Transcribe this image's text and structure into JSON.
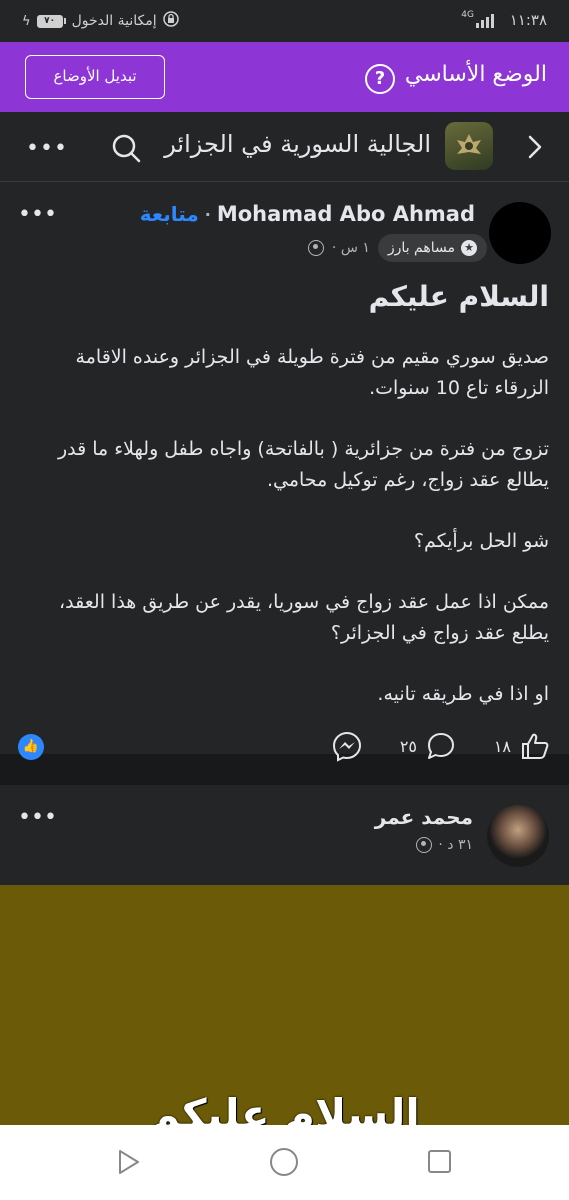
{
  "status_bar": {
    "time": "١١:٣٨",
    "network": "4G",
    "battery": "٧٠",
    "accessibility": "إمكانية الدخول"
  },
  "mode_banner": {
    "title": "الوضع الأساسي",
    "help_icon": "?",
    "switch_label": "تبديل الأوضاع"
  },
  "group_header": {
    "name": "الجالية السورية في الجزائر",
    "more": "•••"
  },
  "post": {
    "author": "Mohamad Abo Ahmad",
    "follow": "متابعة",
    "badge": "مساهم بارز",
    "time": "١ س ·",
    "more": "•••",
    "headline": "السلام عليكم",
    "paragraphs": [
      "صديق سوري مقيم من فترة طويلة في الجزائر وعنده الاقامة الزرقاء تاع 10 سنوات.",
      "تزوج من فترة من جزائرية ( بالفاتحة) واجاه طفل ولهلاء ما قدر يطالع عقد زواج، رغم توكيل محامي.",
      "شو الحل برأيكم؟",
      "ممكن اذا عمل عقد زواج في سوريا، يقدر عن طريق هذا العقد، يطلع عقد زواج في الجزائر؟",
      "او اذا في طريقه تانيه."
    ],
    "likes": "١٨",
    "comments": "٢٥"
  },
  "post2": {
    "author": "محمد عمر",
    "time": "٣١ د ·",
    "more": "•••",
    "media_text": "السلام عليكم",
    "media_color": "#6b5a07"
  },
  "colors": {
    "accent_purple": "#8e35d6",
    "link_blue": "#2d88ff",
    "card_bg": "#242526"
  }
}
